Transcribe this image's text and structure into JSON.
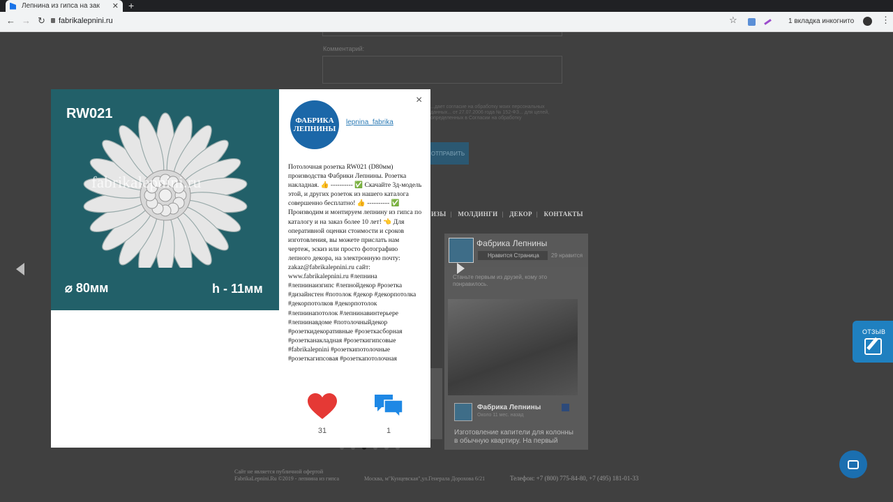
{
  "browser": {
    "tab_title": "Лепнина из гипса на зак",
    "tab_close": "✕",
    "new_tab": "+",
    "url": "fabrikalepnini.ru",
    "incognito": "1 вкладка инкогнито",
    "back": "←",
    "forward": "→",
    "reload": "↻",
    "star": "☆",
    "menu": "⋮"
  },
  "background_page": {
    "comment_label": "Комментарий:",
    "consent_text": "...дает согласие на обработку моих персональных данных... от 27.07.2006 года № 152-ФЗ... для целей, определенных в Согласии на обработку",
    "send_button": "ОТПРАВИТЬ",
    "nav_items": [
      "ИЗЫ",
      "МОЛДИНГИ",
      "ДЕКОР",
      "КОНТАКТЫ"
    ],
    "fb": {
      "page_name": "Фабрика Лепнины",
      "like_button": "Нравится Страница",
      "likes": "29 нравится",
      "friends_text": "Станьте первым из друзей, кому это понравилось.",
      "post_title": "Фабрика Лепнины",
      "post_time": "Около 11 мес. назад",
      "post_text": "Изготовление капители для колонны в обычную квартиру. На первый"
    },
    "footer_line1": "Сайт не является публичной офертой",
    "footer_line2": "FabrikaLepnini.Ru ©2019 - лепнина из гипса",
    "footer_address": "Москва, м\"Кунцевская\",ул.Генерала Дорохова 6/21",
    "footer_phone": "Телефон: +7 (800) 775-84-80, +7 (495) 181-01-33",
    "feedback_label": "ОТЗЫВ"
  },
  "modal": {
    "photo": {
      "code": "RW021",
      "watermark": "fabrikalepnini.ru",
      "diameter": "⌀ 80мм",
      "height": "h - 11мм"
    },
    "close": "×",
    "avatar_line1": "ФАБРИКА",
    "avatar_line2": "ЛЕПНИНЫ",
    "username": "lepnina_fabrika",
    "caption": "Потолочная розетка RW021 (D80мм) производства Фабрики Лепнины. Розетка накладная. 👍 ---------- ✅ Скачайте 3д-модель этой, и других розеток из нашего каталога совершенно бесплатно! 👍 ---------- ✅ Производим и монтируем лепнину из гипса по каталогу и на заказ более 10 лет! 👈 Для оперативной оценки стоимости и сроков изготовления, вы можете прислать нам чертеж, эскиз или просто фотографию лепного декора, на электронную почту: zakaz@fabrikalepnini.ru сайт: www.fabrikalepnini.ru #лепнина #лепнинаизгипс #лепнойдекор #розетка #дизайнстен #потолок #декор #декорпотолка #декорпотолков #декорпотолок #лепнинапотолок #лепнинавинтерьере #лепнинавдоме #потолочныйдекор #розеткидекоративные #розеткасборная #розетканакладная #розеткигипсовые #fabrikalepnini #розеткипотолочные #розеткагипсовая #розеткапотолочная",
    "likes": "31",
    "comments": "1"
  },
  "colors": {
    "accent": "#1f80c0",
    "photo_bg": "#226069",
    "heart": "#e53935",
    "comment": "#1e88e5"
  }
}
